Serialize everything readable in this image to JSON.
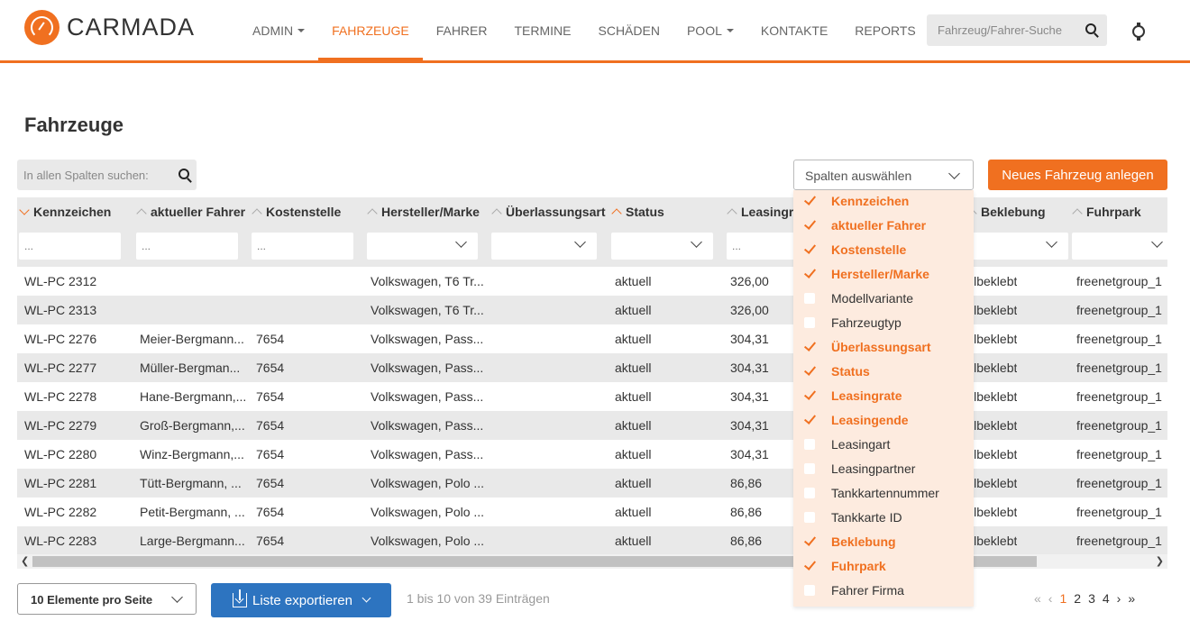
{
  "header": {
    "brand": "CARMADA",
    "nav": [
      {
        "label": "ADMIN",
        "caret": true,
        "active": false
      },
      {
        "label": "FAHRZEUGE",
        "caret": false,
        "active": true
      },
      {
        "label": "FAHRER",
        "caret": false,
        "active": false
      },
      {
        "label": "TERMINE",
        "caret": false,
        "active": false
      },
      {
        "label": "SCHÄDEN",
        "caret": false,
        "active": false
      },
      {
        "label": "POOL",
        "caret": true,
        "active": false
      },
      {
        "label": "KONTAKTE",
        "caret": false,
        "active": false
      },
      {
        "label": "REPORTS",
        "caret": false,
        "active": false
      }
    ],
    "search_placeholder": "Fahrzeug/Fahrer-Suche",
    "accent_color": "#f07020"
  },
  "page": {
    "title": "Fahrzeuge",
    "table_search_placeholder": "In allen Spalten suchen:",
    "column_select_label": "Spalten auswählen",
    "new_button": "Neues Fahrzeug anlegen"
  },
  "table": {
    "columns": [
      {
        "label": "Kennzeichen",
        "sort": "desc",
        "filter": "..."
      },
      {
        "label": "aktueller Fahrer",
        "sort": "none",
        "filter": "..."
      },
      {
        "label": "Kostenstelle",
        "sort": "none",
        "filter": "..."
      },
      {
        "label": "Hersteller/Marke",
        "sort": "none",
        "filter": ""
      },
      {
        "label": "Überlassungsart",
        "sort": "none",
        "filter": ""
      },
      {
        "label": "Status",
        "sort": "asc",
        "filter": ""
      },
      {
        "label": "Leasingrate",
        "sort": "none",
        "filter": "..."
      },
      {
        "label": "Beklebung",
        "sort": "none",
        "filter": ""
      },
      {
        "label": "Fuhrpark",
        "sort": "none",
        "filter": ""
      }
    ],
    "rows": [
      [
        "WL-PC 2312",
        "",
        "",
        "Volkswagen, T6 Tr...",
        "",
        "aktuell",
        "326,00",
        "llbeklebt",
        "freenetgroup_1"
      ],
      [
        "WL-PC 2313",
        "",
        "",
        "Volkswagen, T6 Tr...",
        "",
        "aktuell",
        "326,00",
        "llbeklebt",
        "freenetgroup_1"
      ],
      [
        "WL-PC 2276",
        "Meier-Bergmann...",
        "7654",
        "Volkswagen, Pass...",
        "",
        "aktuell",
        "304,31",
        "llbeklebt",
        "freenetgroup_1"
      ],
      [
        "WL-PC 2277",
        "Müller-Bergman...",
        "7654",
        "Volkswagen, Pass...",
        "",
        "aktuell",
        "304,31",
        "llbeklebt",
        "freenetgroup_1"
      ],
      [
        "WL-PC 2278",
        "Hane-Bergmann,...",
        "7654",
        "Volkswagen, Pass...",
        "",
        "aktuell",
        "304,31",
        "llbeklebt",
        "freenetgroup_1"
      ],
      [
        "WL-PC 2279",
        "Groß-Bergmann,...",
        "7654",
        "Volkswagen, Pass...",
        "",
        "aktuell",
        "304,31",
        "llbeklebt",
        "freenetgroup_1"
      ],
      [
        "WL-PC 2280",
        "Winz-Bergmann,...",
        "7654",
        "Volkswagen, Pass...",
        "",
        "aktuell",
        "304,31",
        "llbeklebt",
        "freenetgroup_1"
      ],
      [
        "WL-PC 2281",
        "Tütt-Bergmann, ...",
        "7654",
        "Volkswagen, Polo ...",
        "",
        "aktuell",
        "86,86",
        "llbeklebt",
        "freenetgroup_1"
      ],
      [
        "WL-PC 2282",
        "Petit-Bergmann, ...",
        "7654",
        "Volkswagen, Polo ...",
        "",
        "aktuell",
        "86,86",
        "llbeklebt",
        "freenetgroup_1"
      ],
      [
        "WL-PC 2283",
        "Large-Bergmann...",
        "7654",
        "Volkswagen, Polo ...",
        "",
        "aktuell",
        "86,86",
        "llbeklebt",
        "freenetgroup_1"
      ]
    ]
  },
  "column_menu": [
    {
      "label": "Kennzeichen",
      "checked": true
    },
    {
      "label": "aktueller Fahrer",
      "checked": true
    },
    {
      "label": "Kostenstelle",
      "checked": true
    },
    {
      "label": "Hersteller/Marke",
      "checked": true
    },
    {
      "label": "Modellvariante",
      "checked": false
    },
    {
      "label": "Fahrzeugtyp",
      "checked": false
    },
    {
      "label": "Überlassungsart",
      "checked": true
    },
    {
      "label": "Status",
      "checked": true
    },
    {
      "label": "Leasingrate",
      "checked": true
    },
    {
      "label": "Leasingende",
      "checked": true
    },
    {
      "label": "Leasingart",
      "checked": false
    },
    {
      "label": "Leasingpartner",
      "checked": false
    },
    {
      "label": "Tankkartennummer",
      "checked": false
    },
    {
      "label": "Tankkarte ID",
      "checked": false
    },
    {
      "label": "Beklebung",
      "checked": true
    },
    {
      "label": "Fuhrpark",
      "checked": true
    },
    {
      "label": "Fahrer Firma",
      "checked": false
    }
  ],
  "footer": {
    "per_page": "10 Elemente pro Seite",
    "export": "Liste exportieren",
    "info": "1 bis 10 von 39 Einträgen",
    "pages": [
      "1",
      "2",
      "3",
      "4"
    ],
    "current_page": "1"
  }
}
